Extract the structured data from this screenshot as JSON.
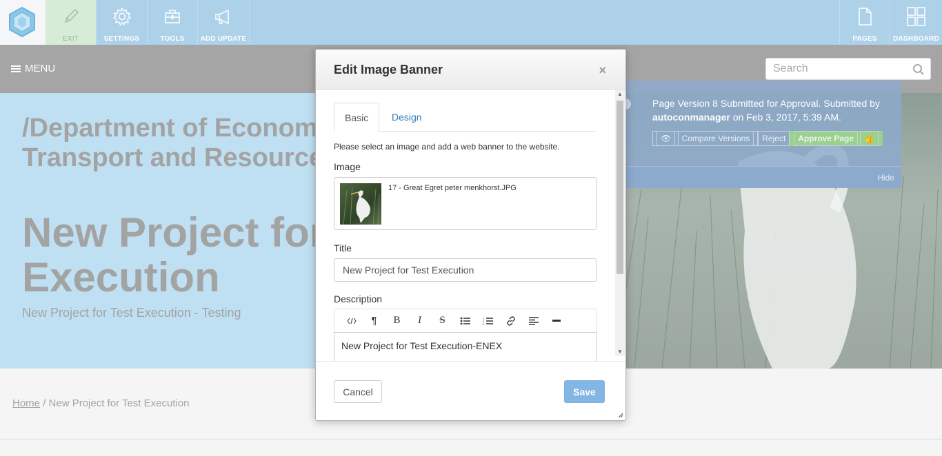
{
  "toolbar": {
    "exit_label": "EXIT",
    "settings_label": "SETTINGS",
    "tools_label": "TOOLS",
    "add_update_label": "ADD UPDATE",
    "pages_label": "PAGES",
    "dashboard_label": "DASHBOARD"
  },
  "nav": {
    "menu_label": "MENU",
    "search_placeholder": "Search"
  },
  "hero": {
    "department": "/Department of Economic Development, Jobs, Transport and Resources",
    "title": "New Project for Test Execution",
    "subtitle": "New Project for Test Execution - Testing"
  },
  "breadcrumb": {
    "home": "Home",
    "separator": "/",
    "current": "New Project for Test Execution"
  },
  "notification": {
    "message_prefix": "Page Version 8 Submitted for Approval. Submitted by",
    "user": "autoconmanager",
    "message_suffix": "on Feb 3, 2017, 5:39 AM.",
    "compare_label": "Compare Versions",
    "reject_label": "Reject",
    "approve_label": "Approve Page",
    "hide_label": "Hide"
  },
  "modal": {
    "title": "Edit Image Banner",
    "close_glyph": "×",
    "tabs": [
      {
        "label": "Basic",
        "active": true
      },
      {
        "label": "Design",
        "active": false
      }
    ],
    "intro": "Please select an image and add a web banner to the website.",
    "image_label": "Image",
    "image_filename": "17 - Great Egret peter menkhorst.JPG",
    "title_label": "Title",
    "title_value": "New Project for Test Execution",
    "description_label": "Description",
    "editor_tools": [
      "code-icon",
      "paragraph-icon",
      "bold-icon",
      "italic-icon",
      "strikethrough-icon",
      "bullet-list-icon",
      "numbered-list-icon",
      "link-icon",
      "align-icon",
      "horizontal-rule-icon"
    ],
    "description_value": "New Project for Test Execution-ENEX",
    "cancel_label": "Cancel",
    "save_label": "Save"
  },
  "colors": {
    "toolbar_bg": "#aed1ea",
    "navbar_bg": "#a5a5a5",
    "hero_bg": "#bfe0f3",
    "approve_green": "#9ad28b",
    "save_blue": "#82b6e4",
    "link_blue": "#337ab7"
  }
}
